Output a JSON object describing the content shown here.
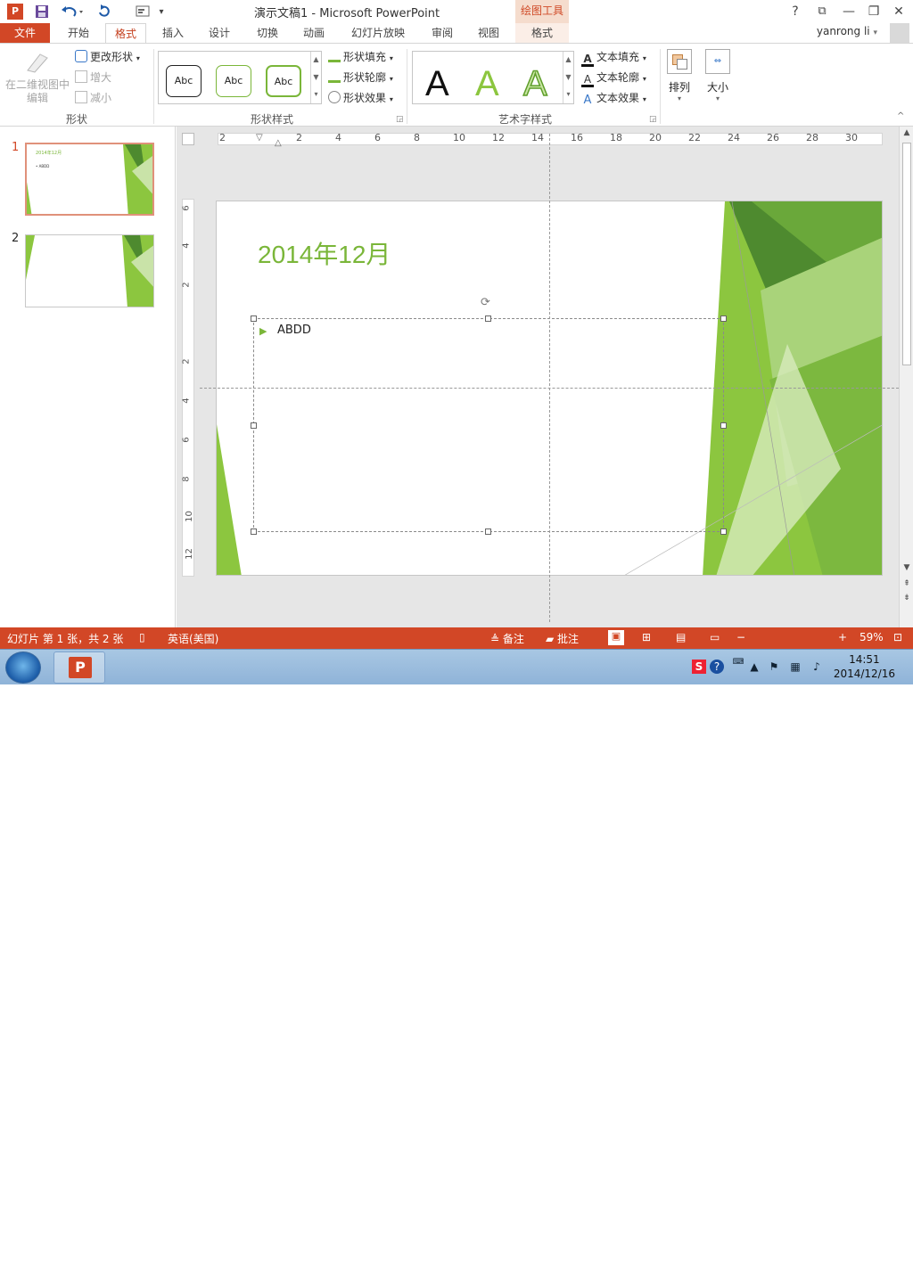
{
  "titlebar": {
    "app_logo": "P",
    "title": "演示文稿1 - Microsoft PowerPoint",
    "contextual_group": "绘图工具",
    "help": "?",
    "restore": "⧉",
    "minimize": "—",
    "maximize": "❐",
    "close": "✕"
  },
  "tabs": {
    "file": "文件",
    "home": "开始",
    "format": "格式",
    "insert": "插入",
    "design": "设计",
    "transitions": "切换",
    "animations": "动画",
    "slideshow": "幻灯片放映",
    "review": "审阅",
    "view": "视图",
    "format2": "格式",
    "user": "yanrong li"
  },
  "ribbon": {
    "shapes_group": {
      "label": "形状",
      "edit_in_2d": "在二维视图中编辑",
      "change_shape": "更改形状",
      "larger": "增大",
      "smaller": "减小"
    },
    "shape_styles": {
      "label": "形状样式",
      "items": [
        "Abc",
        "Abc",
        "Abc"
      ],
      "fill": "形状填充",
      "outline": "形状轮廓",
      "effects": "形状效果"
    },
    "wordart_styles": {
      "label": "艺术字样式",
      "items": [
        "A",
        "A",
        "A"
      ],
      "text_fill": "文本填充",
      "text_outline": "文本轮廓",
      "text_effects": "文本效果"
    },
    "arrange": "排列",
    "size": "大小"
  },
  "slides_panel": {
    "thumbs": [
      {
        "number": "1",
        "title": "2014年12月",
        "text": "• ABDD"
      },
      {
        "number": "2"
      }
    ]
  },
  "ruler": {
    "horizontal": [
      "2",
      "2",
      "4",
      "6",
      "8",
      "10",
      "12",
      "14",
      "16",
      "18",
      "20",
      "22",
      "24",
      "26",
      "28",
      "30"
    ],
    "vertical": [
      "6",
      "4",
      "2",
      "2",
      "4",
      "6",
      "8",
      "10",
      "12"
    ]
  },
  "slide": {
    "title": "2014年12月",
    "bullet_text": "ABDD"
  },
  "statusbar": {
    "slide_info": "幻灯片 第 1 张，共 2 张",
    "language": "英语(美国)",
    "notes": "备注",
    "comments": "批注",
    "zoom": "59%"
  },
  "taskbar": {
    "time": "14:51",
    "date": "2014/12/16"
  },
  "colors": {
    "accent": "#d24726",
    "green": "#7ab639"
  }
}
